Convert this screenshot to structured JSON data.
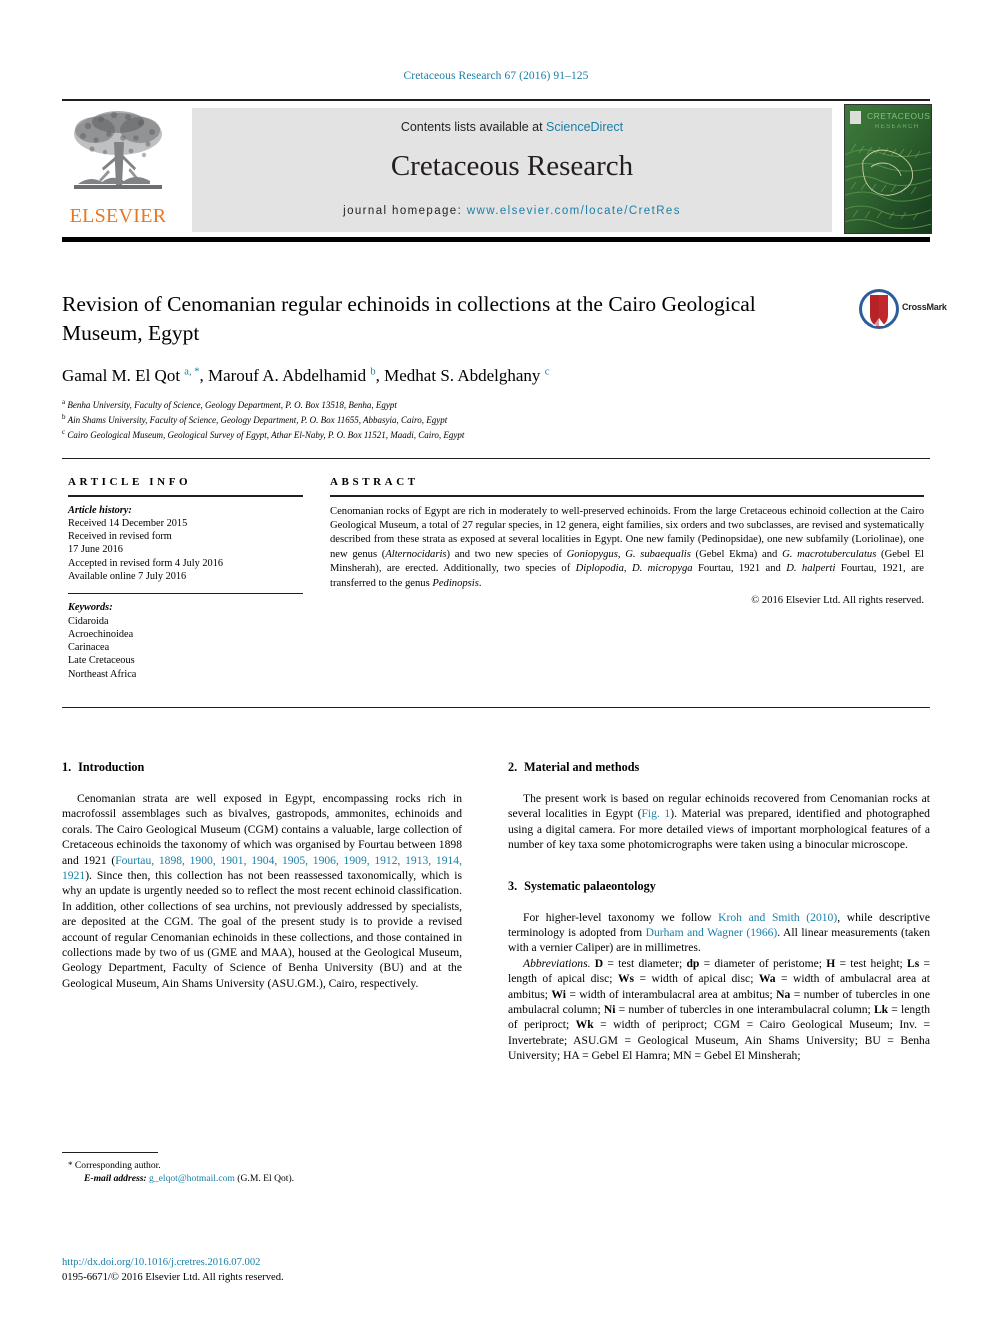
{
  "running_head": "Cretaceous Research 67 (2016) 91–125",
  "masthead": {
    "contents_prefix": "Contents lists available at ",
    "contents_link": "ScienceDirect",
    "journal_name": "Cretaceous Research",
    "homepage_prefix": "journal homepage: ",
    "homepage_url": "www.elsevier.com/locate/CretRes",
    "publisher": "ELSEVIER",
    "cover_title_line1": "CRETACEOUS",
    "cover_title_line2": "RESEARCH"
  },
  "article": {
    "title": "Revision of Cenomanian regular echinoids in collections at the Cairo Geological Museum, Egypt",
    "crossmark_label": "CrossMark",
    "authors_html": "Gamal M. El Qot <sup>a, *</sup>, Marouf A. Abdelhamid <sup>b</sup>, Medhat S. Abdelghany <sup>c</sup>",
    "affiliations": [
      {
        "marker": "a",
        "text": "Benha University, Faculty of Science, Geology Department, P. O. Box 13518, Benha, Egypt"
      },
      {
        "marker": "b",
        "text": "Ain Shams University, Faculty of Science, Geology Department, P. O. Box 11655, Abbasyia, Cairo, Egypt"
      },
      {
        "marker": "c",
        "text": "Cairo Geological Museum, Geological Survey of Egypt, Athar El-Naby, P. O. Box 11521, Maadi, Cairo, Egypt"
      }
    ]
  },
  "article_info": {
    "heading": "ARTICLE INFO",
    "history_label": "Article history:",
    "history_lines": [
      "Received 14 December 2015",
      "Received in revised form",
      "17 June 2016",
      "Accepted in revised form 4 July 2016",
      "Available online 7 July 2016"
    ],
    "keywords_label": "Keywords:",
    "keywords": [
      "Cidaroida",
      "Acroechinoidea",
      "Carinacea",
      "Late Cretaceous",
      "Northeast Africa"
    ]
  },
  "abstract": {
    "heading": "ABSTRACT",
    "html": "Cenomanian rocks of Egypt are rich in moderately to well-preserved echinoids. From the large Cretaceous echinoid collection at the Cairo Geological Museum, a total of 27 regular species, in 12 genera, eight families, six orders and two subclasses, are revised and systematically described from these strata as exposed at several localities in Egypt. One new family (Pedinopsidae), one new subfamily (Loriolinae), one new genus (<i>Alternocidaris</i>) and two new species of <i>Goniopygus</i>, <i>G. subaequalis</i> (Gebel Ekma) and <i>G. macrotuberculatus</i> (Gebel El Minsherah), are erected. Additionally, two species of <i>Diplopodia</i>, <i>D. micropyga</i> Fourtau, 1921 and <i>D. halperti</i> Fourtau, 1921, are transferred to the genus <i>Pedinopsis</i>.",
    "copyright": "© 2016 Elsevier Ltd. All rights reserved."
  },
  "sections": {
    "introduction": {
      "number": "1.",
      "title": "Introduction",
      "paragraph_html": "Cenomanian strata are well exposed in Egypt, encompassing rocks rich in macrofossil assemblages such as bivalves, gastropods, ammonites, echinoids and corals. The Cairo Geological Museum (CGM) contains a valuable, large collection of Cretaceous echinoids the taxonomy of which was organised by Fourtau between 1898 and 1921 (<span class=\"lnk\">Fourtau, 1898, 1900, 1901, 1904, 1905, 1906, 1909, 1912, 1913, 1914, 1921</span>). Since then, this collection has not been reassessed taxonomically, which is why an update is urgently needed so to reflect the most recent echinoid classification. In addition, other collections of sea urchins, not previously addressed by specialists, are deposited at the CGM. The goal of the present study is to provide a revised account of regular Cenomanian echinoids in these collections, and those contained in collections made by two of us (GME and MAA), housed at the Geological Museum, Geology Department, Faculty of Science of Benha University (BU) and at the Geological Museum, Ain Shams University (ASU.GM.), Cairo, respectively."
    },
    "material_methods": {
      "number": "2.",
      "title": "Material and methods",
      "paragraph_html": "The present work is based on regular echinoids recovered from Cenomanian rocks at several localities in Egypt (<span class=\"lnk\">Fig. 1</span>). Material was prepared, identified and photographed using a digital camera. For more detailed views of important morphological features of a number of key taxa some photomicrographs were taken using a binocular microscope."
    },
    "systematic_palaeontology": {
      "number": "3.",
      "title": "Systematic palaeontology",
      "paragraph1_html": "For higher-level taxonomy we follow <span class=\"lnk\">Kroh and Smith (2010)</span>, while descriptive terminology is adopted from <span class=\"lnk\">Durham and Wagner (1966)</span>. All linear measurements (taken with a vernier Caliper) are in millimetres.",
      "paragraph2_html": "<span class=\"abbr-lead\">Abbreviations.</span> <b>D</b> = test diameter; <b>dp</b> = diameter of peristome; <b>H</b> = test height; <b>Ls</b> = length of apical disc; <b>Ws</b> = width of apical disc; <b>Wa</b> = width of ambulacral area at ambitus; <b>Wi</b> = width of interambulacral area at ambitus; <b>Na</b> = number of tubercles in one ambulacral column; <b>Ni</b> = number of tubercles in one interambulacral column; <b>Lk</b> = length of periproct; <b>Wk</b> = width of periproct; CGM = Cairo Geological Museum; Inv. = Invertebrate; ASU.GM = Geological Museum, Ain Shams University; BU = Benha University; HA = Gebel El Hamra; MN = Gebel El Minsherah;"
    }
  },
  "footnote": {
    "corresponding_star": "*",
    "corresponding_label": "Corresponding author.",
    "email_label": "E-mail address:",
    "email": "g_elqot@hotmail.com",
    "email_owner": "(G.M. El Qot)."
  },
  "doi_block": {
    "doi_url": "http://dx.doi.org/10.1016/j.cretres.2016.07.002",
    "issn_line": "0195-6671/© 2016 Elsevier Ltd. All rights reserved."
  },
  "colors": {
    "link": "#1a7fa8",
    "elsevier_orange": "#E87722",
    "rule": "#231f20",
    "masthead_band": "#e3e3e3"
  }
}
